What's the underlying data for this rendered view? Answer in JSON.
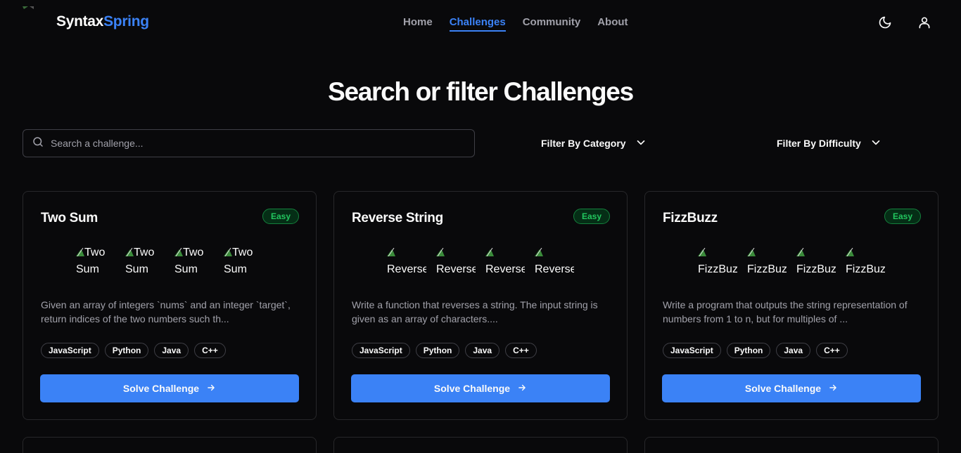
{
  "brand": {
    "part1": "Syntax",
    "part2": "Spring"
  },
  "nav": [
    {
      "label": "Home",
      "active": false
    },
    {
      "label": "Challenges",
      "active": true
    },
    {
      "label": "Community",
      "active": false
    },
    {
      "label": "About",
      "active": false
    }
  ],
  "header_icons": [
    "moon-icon",
    "user-icon"
  ],
  "page_title": "Search or filter Challenges",
  "search": {
    "placeholder": "Search a challenge...",
    "value": ""
  },
  "filters": {
    "category_label": "Filter By Category",
    "difficulty_label": "Filter By Difficulty"
  },
  "colors": {
    "background": "#09090b",
    "accent": "#3b82f6",
    "easy": "#22c55e",
    "border": "#27272a"
  },
  "cards": [
    {
      "title": "Two Sum",
      "difficulty": "Easy",
      "thumb_alt": "Two Sum",
      "description": "Given an array of integers `nums` and an integer `target`, return indices of the two numbers such th...",
      "tags": [
        "JavaScript",
        "Python",
        "Java",
        "C++"
      ],
      "button": "Solve Challenge"
    },
    {
      "title": "Reverse String",
      "difficulty": "Easy",
      "thumb_alt": "Reverse String",
      "description": "Write a function that reverses a string. The input string is given as an array of characters....",
      "tags": [
        "JavaScript",
        "Python",
        "Java",
        "C++"
      ],
      "button": "Solve Challenge"
    },
    {
      "title": "FizzBuzz",
      "difficulty": "Easy",
      "thumb_alt": "FizzBuzz",
      "description": "Write a program that outputs the string representation of numbers from 1 to n, but for multiples of ...",
      "tags": [
        "JavaScript",
        "Python",
        "Java",
        "C++"
      ],
      "button": "Solve Challenge"
    }
  ]
}
